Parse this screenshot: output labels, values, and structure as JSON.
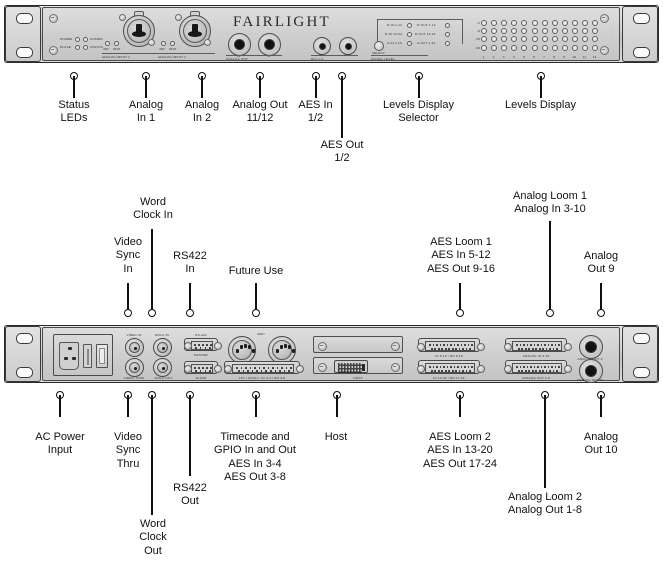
{
  "product": {
    "brand": "FAIRLIGHT"
  },
  "front_panel": {
    "status_leds": [
      {
        "label": "POWER"
      },
      {
        "label": "COMMS"
      },
      {
        "label": "PULSE"
      },
      {
        "label": "STATUS"
      }
    ],
    "inputs": [
      {
        "title": "ANALOG INPUT 1",
        "led_a": "48V",
        "led_b": "INST"
      },
      {
        "title": "ANALOG INPUT 2",
        "led_a": "48V",
        "led_b": "INST"
      }
    ],
    "analog_out": {
      "title": "ANALOG OUT",
      "left": "11",
      "right": "12"
    },
    "dio": {
      "title": "DIO 1-2",
      "left": "IN",
      "right": "OUT"
    },
    "selector": {
      "button": "SELECT",
      "caption": "SIGNAL LEVEL"
    },
    "selector_rows": [
      {
        "left": "D-IN 1-12",
        "right": "D-OUT 1-12"
      },
      {
        "left": "D-IN 13-24",
        "right": "D-OUT 13-24"
      },
      {
        "left": "A-IN 1-10",
        "right": "A-OUT 1-12"
      }
    ],
    "meter": {
      "scale": [
        "-2",
        "-6",
        "-15",
        "-40"
      ],
      "channels": [
        "1",
        "2",
        "3",
        "4",
        "5",
        "6",
        "7",
        "8",
        "9",
        "10",
        "11",
        "12"
      ]
    }
  },
  "rear_panel": {
    "labels": {
      "video_in": "VIDEO IN",
      "wclk_in": "WCLK IN",
      "rs422": "RS-422",
      "master": "MASTER",
      "slave": "SLAVE",
      "video_thru": "VIDEO THRU",
      "wclk_out": "WCLK OUT",
      "midi": "MIDI",
      "midi_in": "IN",
      "midi_out": "OUT",
      "ltc_gpio": "LTC / GPIO1 / DI 3-4 / DO 3-8",
      "host": "HOST",
      "aes_loom_1": "DI 5-12 / DO 9-16",
      "aes_loom_2": "DI 13-20 / DO 17-24",
      "analog_loom_1": "ANALOG IN 3-10",
      "analog_loom_2": "ANALOG OUT 1-8",
      "analog_out_9": "ANALOG OUT 9",
      "analog_out_10": "ANALOG OUT 10"
    }
  },
  "callouts": {
    "front": [
      {
        "text": "Status\nLEDs"
      },
      {
        "text": "Analog\nIn 1"
      },
      {
        "text": "Analog\nIn 2"
      },
      {
        "text": "Analog Out\n11/12"
      },
      {
        "text": "AES In\n1/2"
      },
      {
        "text": "AES Out\n1/2"
      },
      {
        "text": "Levels Display\nSelector"
      },
      {
        "text": "Levels Display"
      }
    ],
    "rear_top": [
      {
        "text": "Video\nSync\nIn"
      },
      {
        "text": "Word\nClock In"
      },
      {
        "text": "RS422\nIn"
      },
      {
        "text": "Future Use"
      },
      {
        "text": "AES Loom 1\nAES In 5-12\nAES Out 9-16"
      },
      {
        "text": "Analog Loom 1\nAnalog In 3-10"
      },
      {
        "text": "Analog\nOut 9"
      }
    ],
    "rear_bottom": [
      {
        "text": "AC Power\nInput"
      },
      {
        "text": "Video\nSync\nThru"
      },
      {
        "text": "Word\nClock\nOut"
      },
      {
        "text": "RS422\nOut"
      },
      {
        "text": "Timecode and\nGPIO In and Out\nAES In 3-4\nAES Out 3-8"
      },
      {
        "text": "Host"
      },
      {
        "text": "AES Loom 2\nAES In 13-20\nAES Out 17-24"
      },
      {
        "text": "Analog Loom 2\nAnalog Out 1-8"
      },
      {
        "text": "Analog\nOut 10"
      }
    ]
  }
}
